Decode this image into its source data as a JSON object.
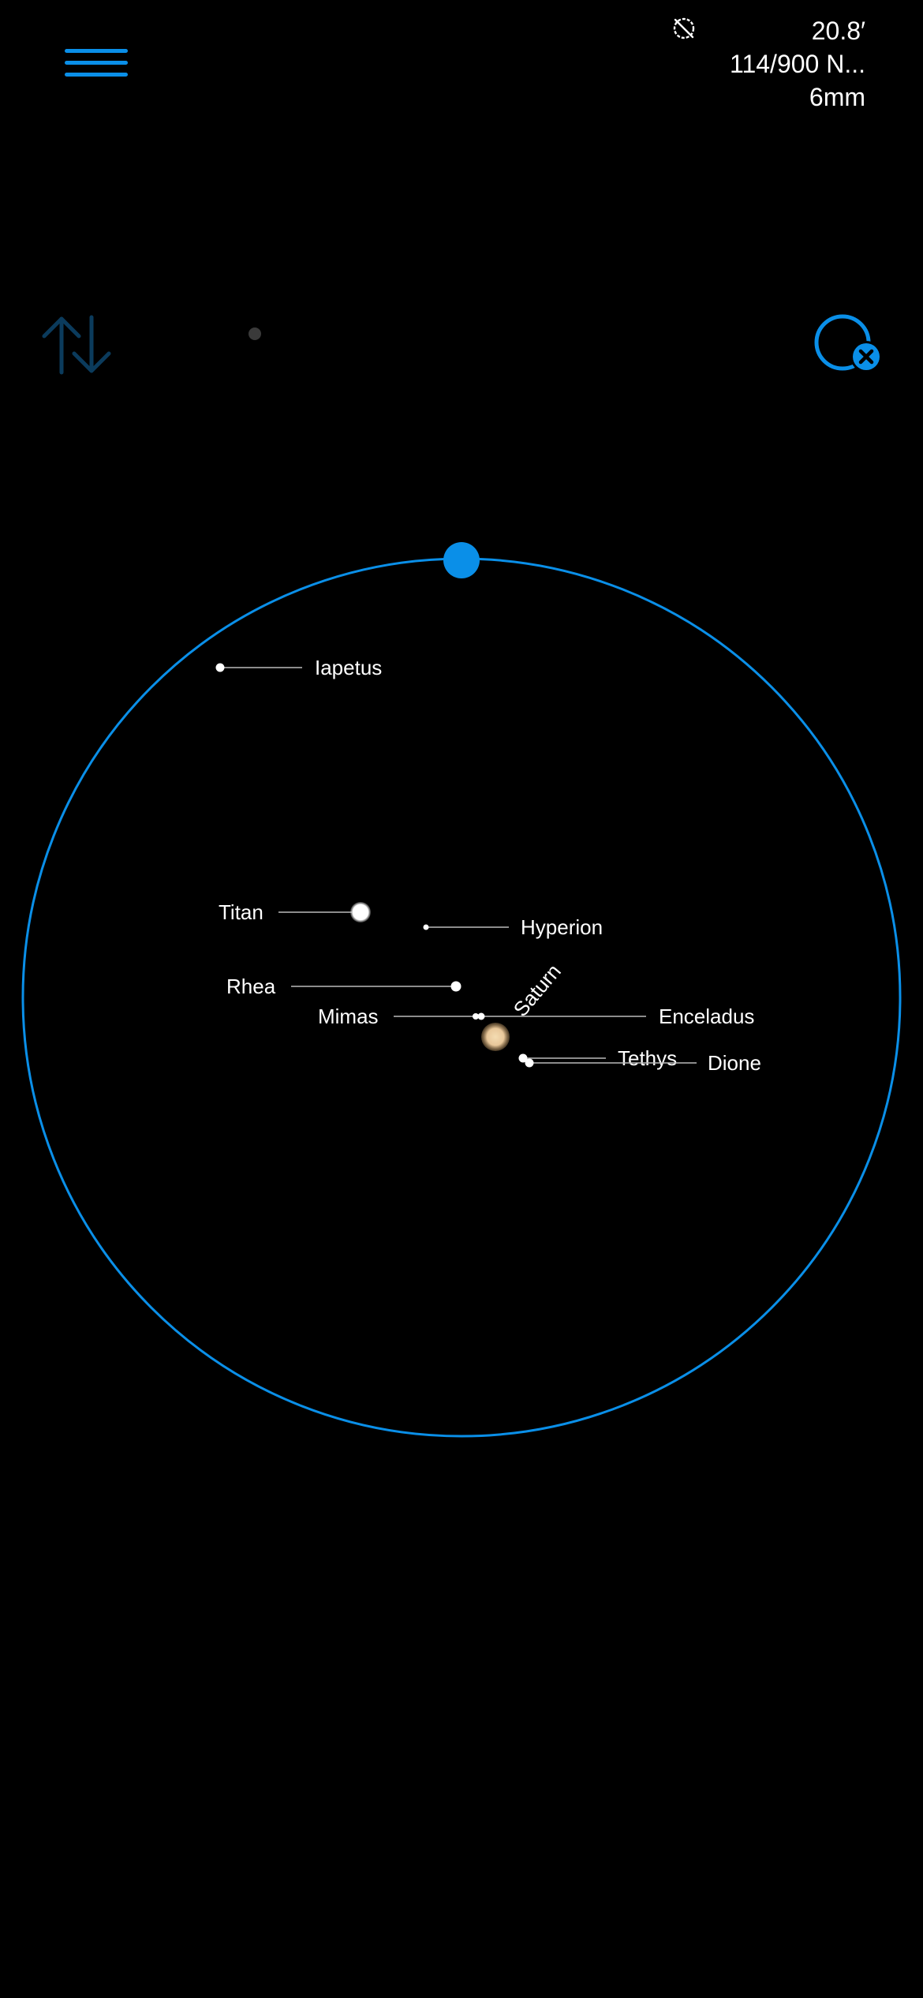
{
  "header": {
    "fov": "20.8′",
    "telescope": "114/900 N...",
    "eyepiece": "6mm"
  },
  "icons": {
    "menu": "hamburger-menu-icon",
    "tracking": "tracking-off-icon",
    "swap": "swap-vertical-arrows-icon",
    "clear_target": "remove-target-circle-icon"
  },
  "colors": {
    "accent": "#0a8fe8",
    "background": "#000000",
    "saturn": "#e8c79a",
    "moon": "#ffffff"
  },
  "planet": {
    "name": "Saturn"
  },
  "moons": [
    {
      "name": "Iapetus"
    },
    {
      "name": "Titan"
    },
    {
      "name": "Hyperion"
    },
    {
      "name": "Rhea"
    },
    {
      "name": "Mimas"
    },
    {
      "name": "Enceladus"
    },
    {
      "name": "Tethys"
    },
    {
      "name": "Dione"
    }
  ]
}
